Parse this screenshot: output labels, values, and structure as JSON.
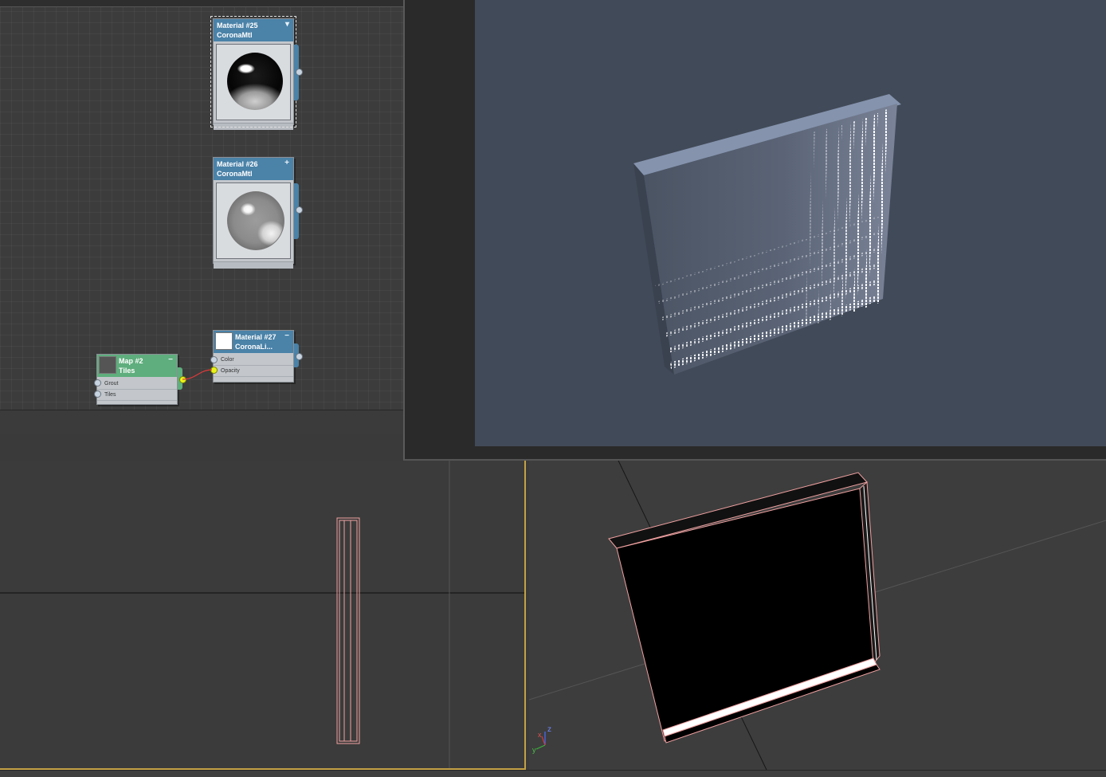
{
  "slate": {
    "nodes": [
      {
        "id": "mat25",
        "line1": "Material #25",
        "line2": "CoronaMtl",
        "control": "▾"
      },
      {
        "id": "mat26",
        "line1": "Material #26",
        "line2": "CoronaMtl",
        "control": "+"
      },
      {
        "id": "mat27",
        "line1": "Material #27",
        "line2": "CoronaLi...",
        "control": "−",
        "sockets": [
          "Color",
          "Opacity"
        ]
      },
      {
        "id": "map2",
        "line1": "Map #2",
        "line2": "Tiles",
        "control": "−",
        "sockets": [
          "Grout",
          "Tiles"
        ]
      }
    ]
  },
  "gizmo": {
    "x_label": "x",
    "y_label": "y",
    "z_label": "z"
  },
  "colors": {
    "material_header": "#4a82a8",
    "map_header": "#5fae7d",
    "render_background": "#414a58",
    "selection_wire": "#f0a0a0",
    "active_viewport_border": "#c3a145",
    "active_socket": "#e9f31a"
  }
}
